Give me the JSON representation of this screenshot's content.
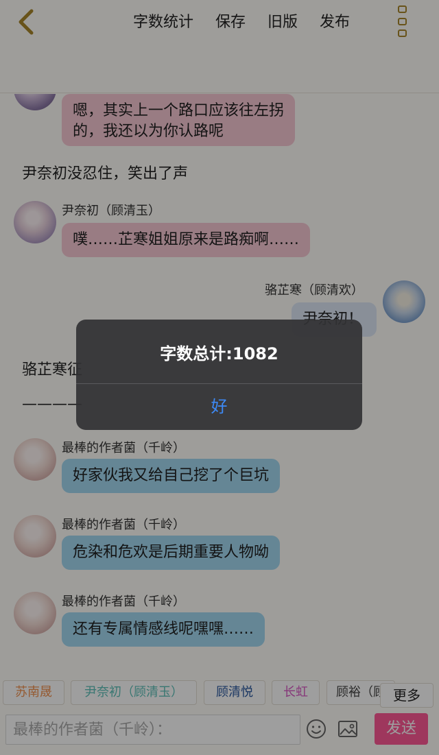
{
  "header": {
    "actions": [
      "字数统计",
      "保存",
      "旧版",
      "发布"
    ]
  },
  "messages": {
    "m1_text_line1": "嗯，其实上一个路口应该往左拐",
    "m1_text_line2": "的，我还以为你认路呢",
    "narration1": "尹奈初没忍住，笑出了声",
    "m2_name": "尹奈初（顾清玉）",
    "m2_text": "噗……芷寒姐姐原来是路痴啊……",
    "m3_name": "骆芷寒（顾清欢）",
    "m3_text": "尹奈初！",
    "narration2": "骆芷寒征",
    "narration3": "————",
    "m4_name": "最棒的作者菌（千岭）",
    "m4_text": "好家伙我又给自己挖了个巨坑",
    "m5_name": "最棒的作者菌（千岭）",
    "m5_text": "危染和危欢是后期重要人物呦",
    "m6_name": "最棒的作者菌（千岭）",
    "m6_text": "还有专属情感线呢嘿嘿……"
  },
  "character_tags": [
    {
      "label": "苏南晟",
      "color": "#f0914f"
    },
    {
      "label": "尹奈初（顾清玉）",
      "color": "#5cc0b8"
    },
    {
      "label": "顾清悦",
      "color": "#2c5aa0"
    },
    {
      "label": "长虹",
      "color": "#d85ac4"
    },
    {
      "label": "顾裕（顾",
      "color": "#444444"
    }
  ],
  "more_label": "更多",
  "input": {
    "placeholder": "最棒的作者菌（千岭）："
  },
  "send_label": "发送",
  "dialog": {
    "title": "字数总计:1082",
    "ok_label": "好"
  }
}
